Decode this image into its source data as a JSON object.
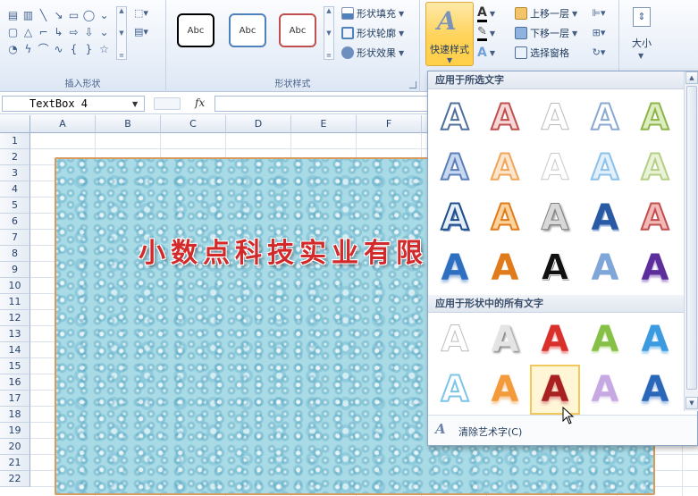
{
  "ribbon": {
    "insert_shapes_group_label": "插入形状",
    "shape_styles_group_label": "形状样式",
    "style_thumbs": [
      "Abc",
      "Abc",
      "Abc"
    ],
    "shape_fill_label": "形状填充",
    "shape_outline_label": "形状轮廓",
    "shape_effects_label": "形状效果",
    "quick_styles_label": "快速样式",
    "bring_forward_label": "上移一层",
    "send_backward_label": "下移一层",
    "selection_pane_label": "选择窗格",
    "size_label": "大小",
    "colors": {
      "black_thumb": "#000000",
      "blue_thumb": "#4f81bd",
      "red_thumb": "#c0504d"
    }
  },
  "formula_bar": {
    "name_box_value": "TextBox 4",
    "fx_label": "fx",
    "formula_value": ""
  },
  "sheet": {
    "columns": [
      "A",
      "B",
      "C",
      "D",
      "E",
      "F"
    ],
    "rows": [
      "1",
      "2",
      "3",
      "4",
      "5",
      "6",
      "7",
      "8",
      "9",
      "10",
      "11",
      "12",
      "13",
      "14",
      "15",
      "16",
      "17",
      "18",
      "19",
      "20",
      "21",
      "22"
    ]
  },
  "textbox": {
    "name": "TextBox 4",
    "text": "小数点科技实业有限公司",
    "text_color": "#d2292a",
    "fill": "water-droplets texture",
    "border_color": "#d99a5e"
  },
  "gallery": {
    "section1_title": "应用于所选文字",
    "section2_title": "应用于形状中的所有文字",
    "clear_label": "清除艺术字(C)",
    "glyph": "A",
    "selected_cell": "section2-row2-col3"
  }
}
